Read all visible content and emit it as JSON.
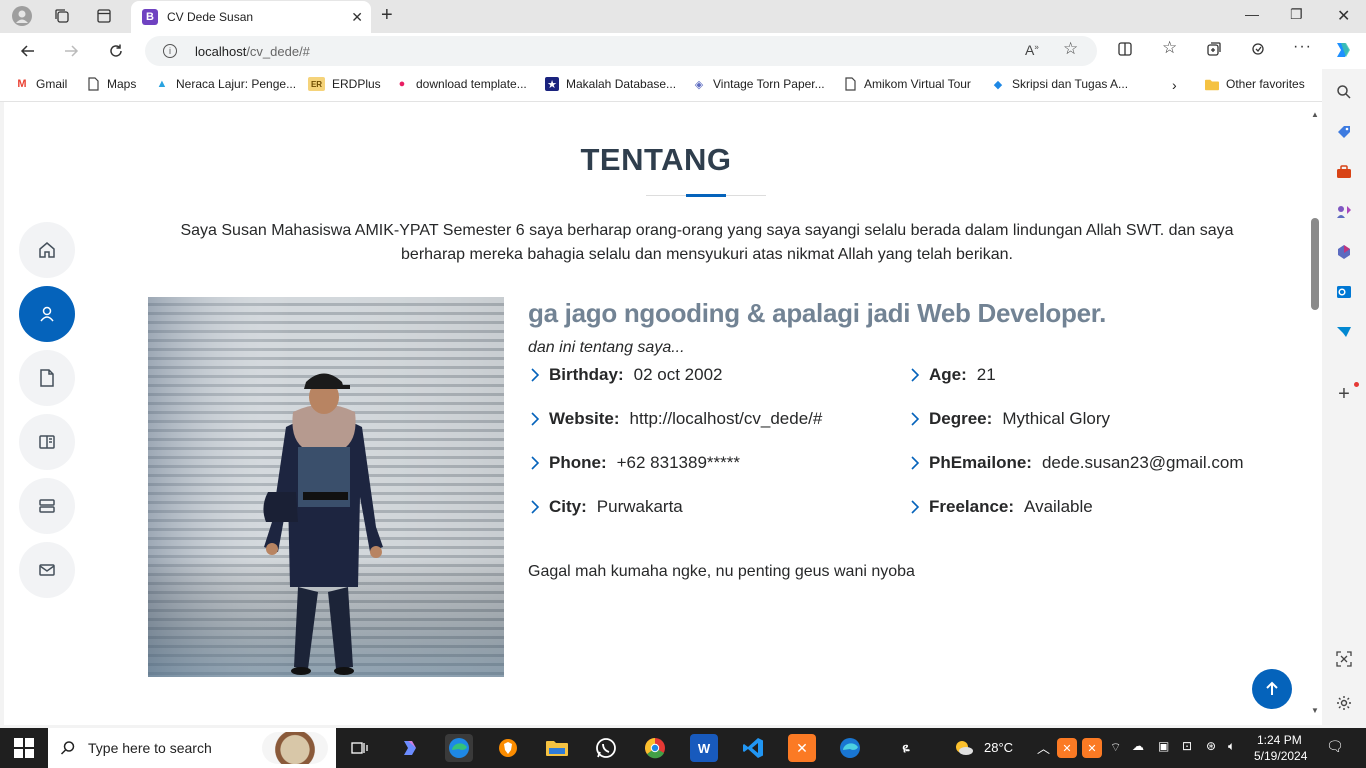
{
  "browser": {
    "tab_title": "CV Dede Susan",
    "tab_favicon_letter": "B",
    "url_host": "localhost",
    "url_path": "/cv_dede/#"
  },
  "favorites": [
    {
      "label": "Gmail",
      "icon": "M",
      "color": "#ea4335"
    },
    {
      "label": "Maps",
      "icon": "▯",
      "color": "#555555"
    },
    {
      "label": "Neraca Lajur: Penge...",
      "icon": "▲",
      "color": "#29a3e0"
    },
    {
      "label": "ERDPlus",
      "icon": "ER",
      "color": "#b8860b"
    },
    {
      "label": "download template...",
      "icon": "●",
      "color": "#e91e63"
    },
    {
      "label": "Makalah Database...",
      "icon": "★",
      "color": "#1a237e"
    },
    {
      "label": "Vintage Torn Paper...",
      "icon": "◈",
      "color": "#5c6bc0"
    },
    {
      "label": "Amikom Virtual Tour",
      "icon": "▯",
      "color": "#555555"
    },
    {
      "label": "Skripsi dan Tugas A...",
      "icon": "◆",
      "color": "#1e88e5"
    }
  ],
  "other_favorites": "Other favorites",
  "about": {
    "title": "TENTANG",
    "intro": "Saya Susan Mahasiswa AMIK-YPAT Semester 6 saya berharap orang-orang yang saya sayangi selalu berada dalam lindungan Allah SWT. dan saya berharap mereka bahagia selalu dan mensyukuri atas nikmat Allah yang telah berikan.",
    "heading": "ga jago ngooding & apalagi jadi Web Developer.",
    "tagline": "dan ini tentang saya...",
    "facts_left": [
      {
        "label": "Birthday:",
        "value": "02 oct 2002"
      },
      {
        "label": "Website:",
        "value": "http://localhost/cv_dede/#"
      },
      {
        "label": "Phone:",
        "value": "+62 831389*****"
      },
      {
        "label": "City:",
        "value": "Purwakarta"
      }
    ],
    "facts_right": [
      {
        "label": "Age:",
        "value": "21"
      },
      {
        "label": "Degree:",
        "value": "Mythical Glory"
      },
      {
        "label": "PhEmailone:",
        "value": "dede.susan23@gmail.com"
      },
      {
        "label": "Freelance:",
        "value": "Available"
      }
    ],
    "closing": "Gagal mah kumaha ngke, nu penting geus wani nyoba"
  },
  "side_nav": [
    {
      "icon": "home-icon",
      "active": false
    },
    {
      "icon": "user-icon",
      "active": true
    },
    {
      "icon": "file-icon",
      "active": false
    },
    {
      "icon": "book-icon",
      "active": false
    },
    {
      "icon": "server-icon",
      "active": false
    },
    {
      "icon": "envelope-icon",
      "active": false
    }
  ],
  "accent_color": "#0563bb",
  "taskbar": {
    "search_placeholder": "Type here to search",
    "weather": "28°C",
    "time": "1:24 PM",
    "date": "5/19/2024"
  }
}
